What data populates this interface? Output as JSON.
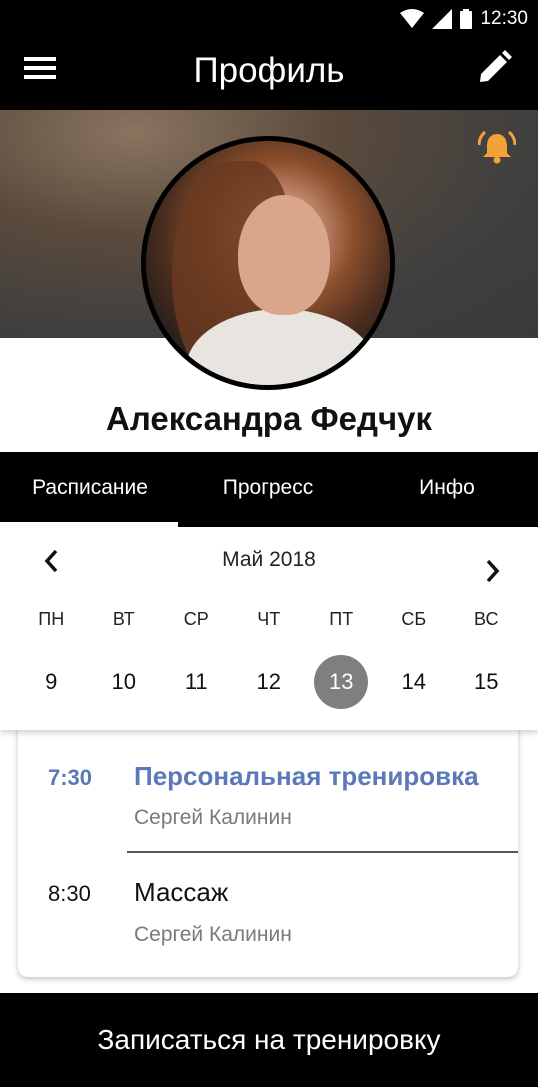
{
  "status_bar": {
    "time": "12:30",
    "icons": [
      "wifi-icon",
      "signal-icon",
      "battery-icon"
    ]
  },
  "app_bar": {
    "title": "Профиль",
    "menu_icon": "menu-icon",
    "edit_icon": "pencil-icon"
  },
  "profile": {
    "name": "Александра Федчук",
    "notification_icon": "bell-ringing-icon",
    "accent_color": "#f2a13b"
  },
  "tabs": [
    {
      "label": "Расписание",
      "active": true
    },
    {
      "label": "Прогресс",
      "active": false
    },
    {
      "label": "Инфо",
      "active": false
    }
  ],
  "calendar": {
    "month": "Май 2018",
    "weekdays": [
      "ПН",
      "ВТ",
      "СР",
      "ЧТ",
      "ПТ",
      "СБ",
      "ВС"
    ],
    "days": [
      "9",
      "10",
      "11",
      "12",
      "13",
      "14",
      "15"
    ],
    "selected_day": "13"
  },
  "events": [
    {
      "time": "7:30",
      "title": "Персональная тренировка",
      "trainer": "Сергей Калинин",
      "highlighted": true,
      "color": "#5b79b8"
    },
    {
      "time": "8:30",
      "title": "Массаж",
      "trainer": "Сергей Калинин",
      "highlighted": false
    }
  ],
  "cta": {
    "label": "Записаться на тренировку"
  }
}
